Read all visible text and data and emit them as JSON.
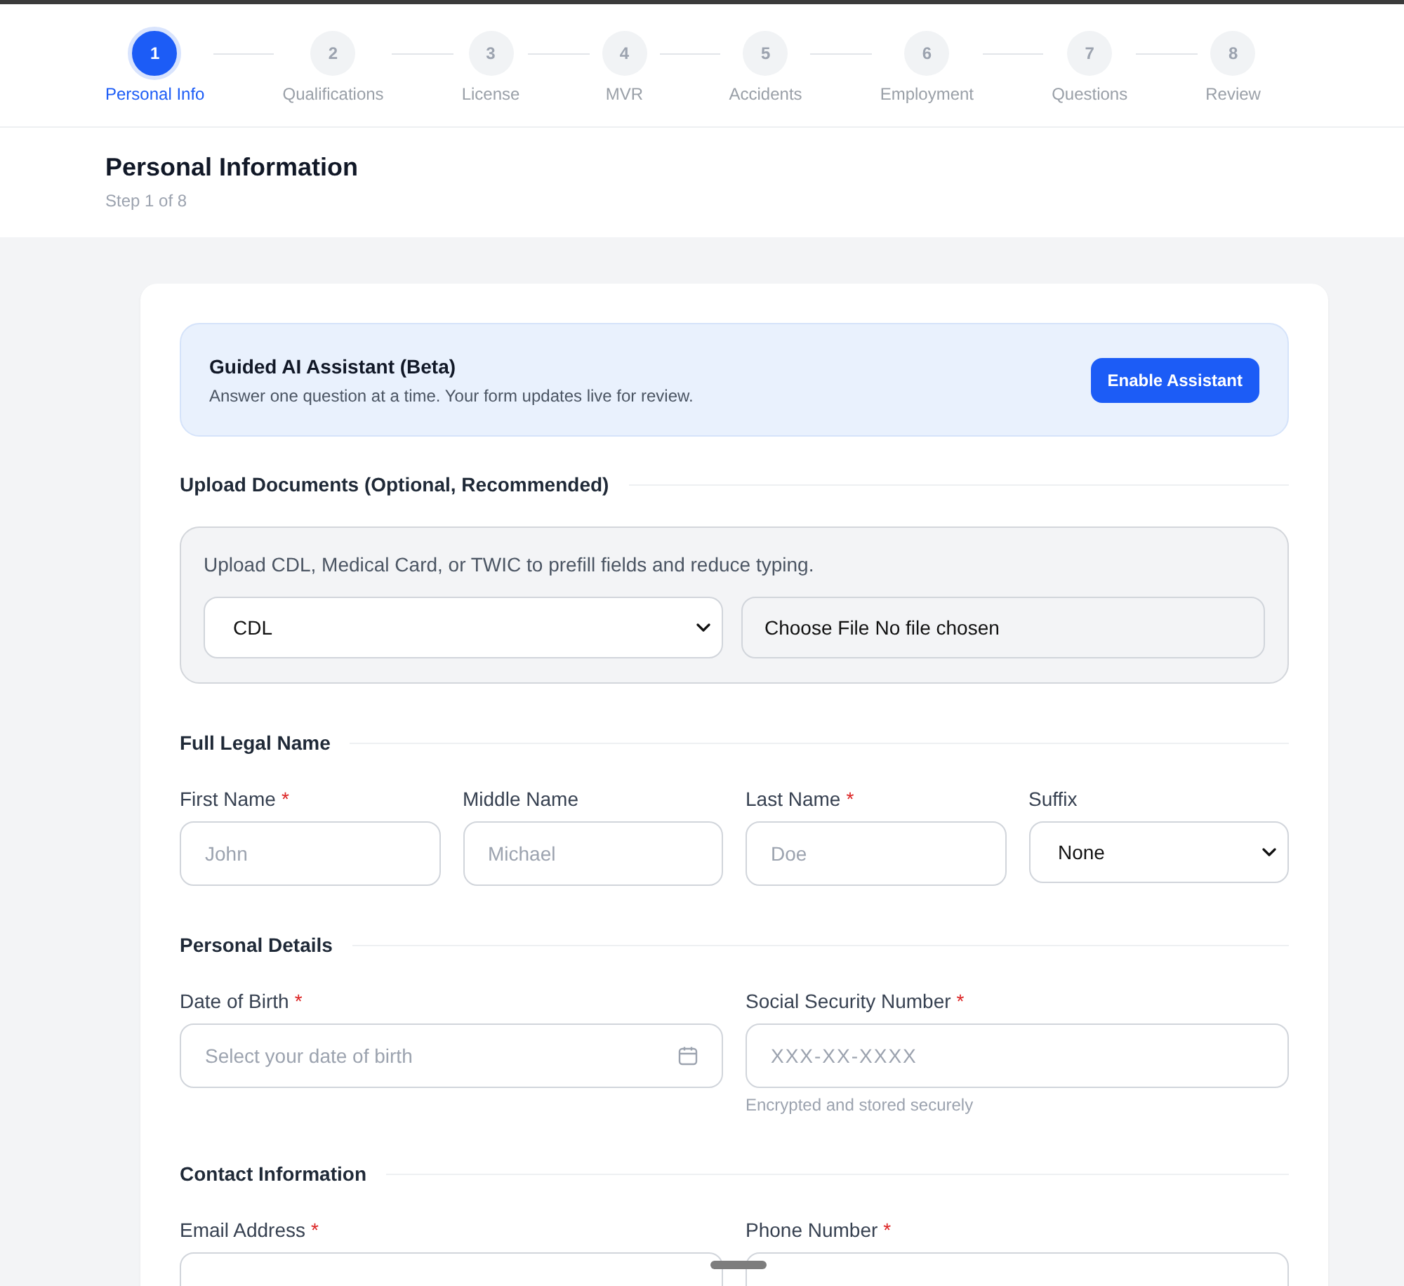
{
  "stepper": {
    "steps": [
      {
        "number": "1",
        "label": "Personal Info",
        "selected": true
      },
      {
        "number": "2",
        "label": "Qualifications",
        "selected": false
      },
      {
        "number": "3",
        "label": "License",
        "selected": false
      },
      {
        "number": "4",
        "label": "MVR",
        "selected": false
      },
      {
        "number": "5",
        "label": "Accidents",
        "selected": false
      },
      {
        "number": "6",
        "label": "Employment",
        "selected": false
      },
      {
        "number": "7",
        "label": "Questions",
        "selected": false
      },
      {
        "number": "8",
        "label": "Review",
        "selected": false
      }
    ]
  },
  "header": {
    "title": "Personal Information",
    "subtitle": "Step 1 of 8"
  },
  "assistant": {
    "title": "Guided AI Assistant (Beta)",
    "description": "Answer one question at a time. Your form updates live for review.",
    "button": "Enable Assistant"
  },
  "sections": [
    {
      "kind": "upload",
      "title": "Upload Documents (Optional, Recommended)",
      "hint": "Upload CDL, Medical Card, or TWIC to prefill fields and reduce typing.",
      "document_type": "CDL",
      "file_button": "Choose File",
      "file_status": "No file chosen"
    },
    {
      "kind": "fields",
      "title": "Full Legal Name",
      "fields": [
        {
          "kind": "text",
          "label": "First Name",
          "required_mark": "*",
          "placeholder": "John"
        },
        {
          "kind": "text",
          "label": "Middle Name",
          "placeholder": "Michael"
        },
        {
          "kind": "text",
          "label": "Last Name",
          "required_mark": "*",
          "placeholder": "Doe"
        },
        {
          "kind": "select",
          "label": "Suffix",
          "value": "None"
        }
      ]
    },
    {
      "kind": "fields",
      "title": "Personal Details",
      "fields": [
        {
          "kind": "date",
          "label": "Date of Birth",
          "required_mark": "*",
          "placeholder": "Select your date of birth"
        },
        {
          "kind": "masked",
          "label": "Social Security Number",
          "required_mark": "*",
          "placeholder": "XXX-XX-XXXX",
          "helper": "Encrypted and stored securely"
        }
      ]
    },
    {
      "kind": "fields",
      "title": "Contact Information",
      "fields": [
        {
          "kind": "text",
          "label": "Email Address",
          "required_mark": "*"
        },
        {
          "kind": "text",
          "label": "Phone Number",
          "required_mark": "*"
        }
      ]
    }
  ]
}
